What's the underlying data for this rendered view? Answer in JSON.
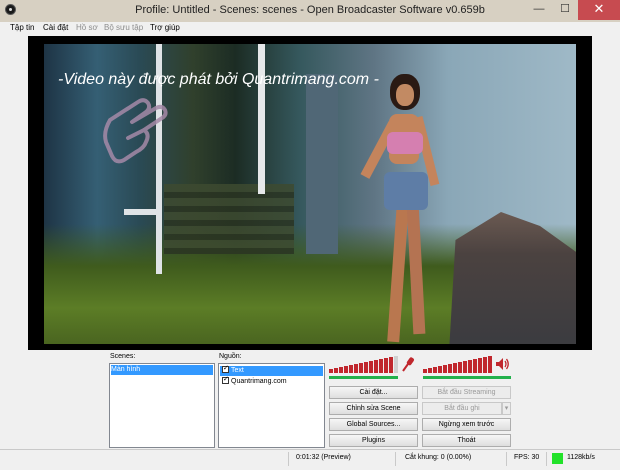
{
  "window": {
    "title": "Profile: Untitled - Scenes: scenes - Open Broadcaster Software v0.659b",
    "minimize_glyph": "—",
    "maximize_glyph": "☐",
    "close_glyph": "✕"
  },
  "menu": {
    "items": [
      {
        "label": "Tập tin",
        "enabled": true
      },
      {
        "label": "Cài đặt",
        "enabled": true
      },
      {
        "label": "Hồ sơ",
        "enabled": false
      },
      {
        "label": "Bộ sưu tập",
        "enabled": false
      },
      {
        "label": "Trợ giúp",
        "enabled": true
      }
    ]
  },
  "preview": {
    "watermark": "-Video này được phát bởi Quantrimang.com -"
  },
  "scenes": {
    "label": "Scenes:",
    "items": [
      {
        "label": "Màn hình",
        "selected": true
      }
    ]
  },
  "sources": {
    "label": "Nguồn:",
    "items": [
      {
        "label": "Text",
        "checked": true,
        "selected": true
      },
      {
        "label": "Quantrimang.com",
        "checked": true,
        "selected": false
      }
    ]
  },
  "audio": {
    "mic_level": 0.8,
    "desktop_level": 0.85,
    "mic_icon": "microphone-icon",
    "speaker_icon": "speaker-icon",
    "meter_color": "#22b14c",
    "active_color": "#c0272d"
  },
  "buttons": {
    "settings": "Cài đặt...",
    "start_streaming": "Bắt đầu Streaming",
    "edit_scene": "Chỉnh sửa Scene",
    "start_recording": "Bắt đầu ghi",
    "global_sources": "Global Sources...",
    "stop_preview": "Ngừng xem trước",
    "plugins": "Plugins",
    "exit": "Thoát"
  },
  "status": {
    "time": "0:01:32 (Preview)",
    "dropped_frames": "Cắt khung: 0 (0.00%)",
    "fps": "FPS: 30",
    "bitrate": "1128kb/s",
    "indicator_color": "#22e22a"
  }
}
